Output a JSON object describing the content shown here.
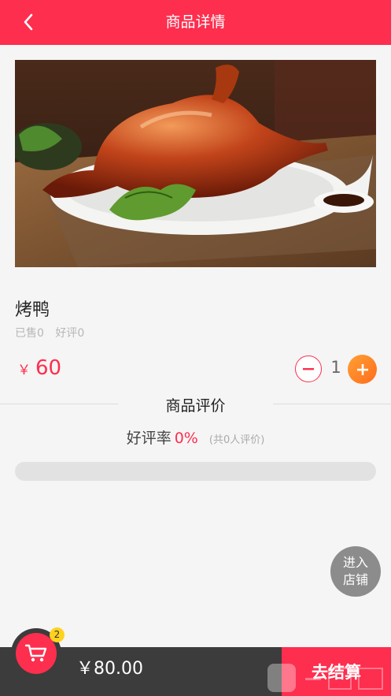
{
  "header": {
    "title": "商品详情"
  },
  "product": {
    "name": "烤鸭",
    "sold": "已售0",
    "good_reviews": "好评0",
    "currency": "￥",
    "price": "60",
    "quantity": "1"
  },
  "reviews": {
    "section_title": "商品评价",
    "rate_label": "好评率",
    "rate_value": "0%",
    "count_text": "(共0人评价)",
    "good_rate_fraction": 0
  },
  "shop_button": {
    "line1": "进入",
    "line2": "店铺"
  },
  "cart": {
    "badge_count": "2",
    "total": "￥80.00",
    "checkout_label": "去结算"
  },
  "colors": {
    "accent": "#fe2e4e",
    "plus_button": "#ff8a27",
    "bottom_bar": "#3c3c3c"
  },
  "icons": {
    "back": "chevron-left-icon",
    "minus": "minus-icon",
    "plus": "plus-icon",
    "cart": "shopping-cart-icon"
  }
}
